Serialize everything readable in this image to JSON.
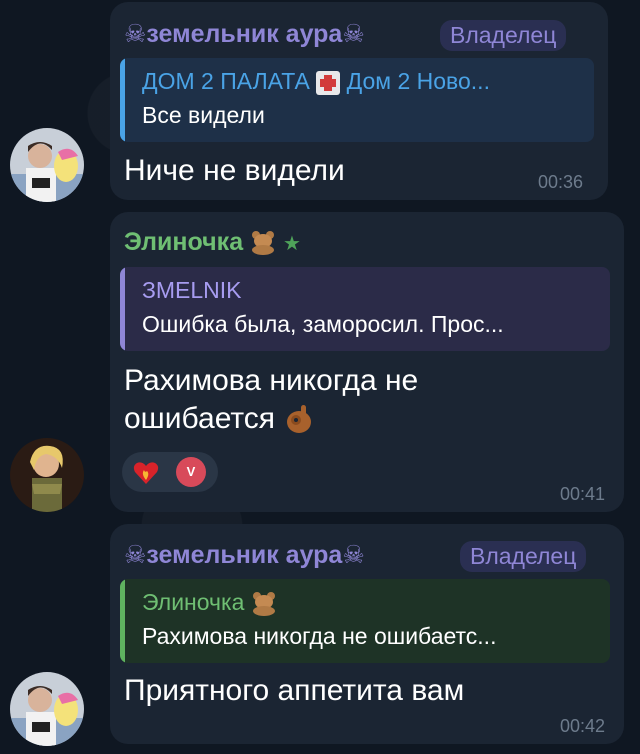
{
  "messages": [
    {
      "sender": "земельник аура",
      "role": "Владелец",
      "quote": {
        "title": "ДОМ 2 ПАЛАТА",
        "title_suffix": "Дом 2 Ново...",
        "text": "Все видели"
      },
      "text": "Ниче не видели",
      "time": "00:36"
    },
    {
      "sender": "Элиночка",
      "quote": {
        "title": "ЗMELNIK",
        "text": "Ошибка была, заморосил. Проc..."
      },
      "text_line1": "Рахимова никогда не",
      "text_line2": "ошибается",
      "reaction_badge": "V",
      "time": "00:41"
    },
    {
      "sender": "земельник аура",
      "role": "Владелец",
      "quote": {
        "title": "Элиночка",
        "text": "Рахимова никогда не ошибаетс..."
      },
      "text": "Приятного аппетита вам",
      "time": "00:42"
    }
  ],
  "colors": {
    "background": "#0e1621",
    "bubble": "#1b2533",
    "sender_owner": "#8f86d6",
    "sender_elinochka": "#6fbf73",
    "quote_blue": "#4aa3e6",
    "quote_purple": "#8f86d6",
    "quote_green": "#5fb35f",
    "time": "#6d7b8c"
  }
}
